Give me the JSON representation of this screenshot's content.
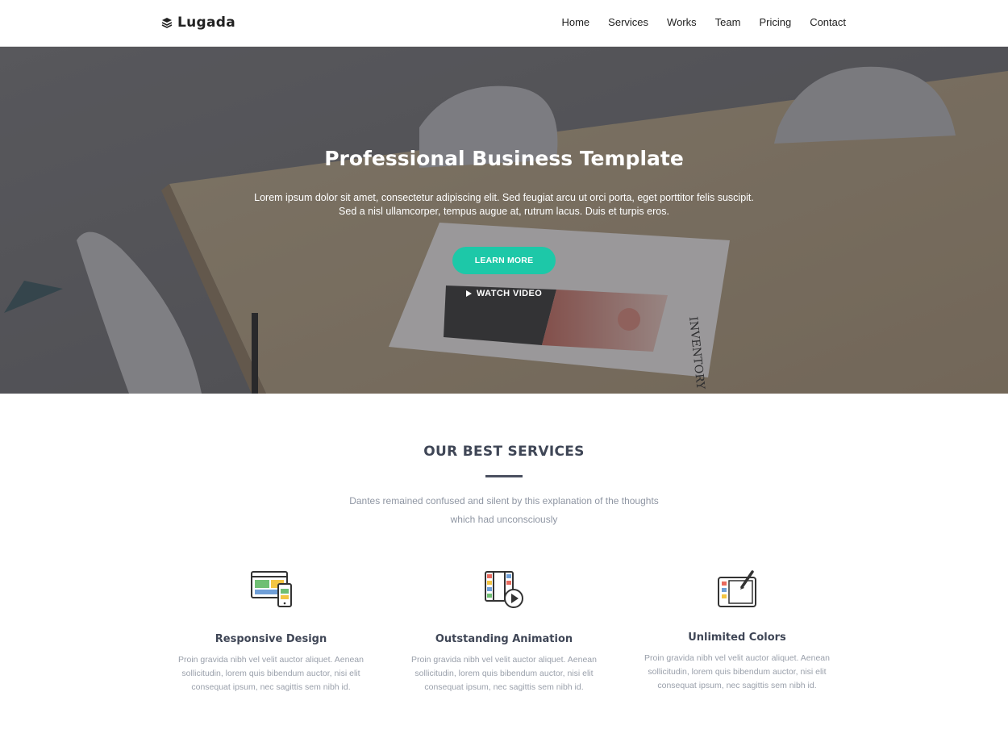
{
  "brand": {
    "name": "Lugada",
    "icon": "layers-icon"
  },
  "nav": {
    "items": [
      {
        "label": "Home"
      },
      {
        "label": "Services"
      },
      {
        "label": "Works"
      },
      {
        "label": "Team"
      },
      {
        "label": "Pricing"
      },
      {
        "label": "Contact"
      }
    ]
  },
  "hero": {
    "title": "Professional Business Template",
    "subtitle_line1": "Lorem ipsum dolor sit amet, consectetur adipiscing elit. Sed feugiat arcu ut orci porta, eget porttitor felis suscipit.",
    "subtitle_line2": "Sed a nisl ullamcorper, tempus augue at, rutrum lacus. Duis et turpis eros.",
    "cta_label": "LEARN MORE",
    "video_label": "WATCH VIDEO",
    "magazine_title": "INVENTORY",
    "accent_color": "#1dc8a8"
  },
  "services": {
    "title": "OUR BEST SERVICES",
    "subtitle_line1": "Dantes remained confused and silent by this explanation of the thoughts",
    "subtitle_line2": "which had unconsciously",
    "items": [
      {
        "icon": "responsive-devices-icon",
        "title": "Responsive Design",
        "text_line1": "Proin gravida nibh vel velit auctor aliquet. Aenean",
        "text_line2": "sollicitudin, lorem quis bibendum auctor, nisi elit",
        "text_line3": "consequat ipsum, nec sagittis sem nibh id."
      },
      {
        "icon": "film-play-icon",
        "title": "Outstanding Animation",
        "text_line1": "Proin gravida nibh vel velit auctor aliquet. Aenean",
        "text_line2": "sollicitudin, lorem quis bibendum auctor, nisi elit",
        "text_line3": "consequat ipsum, nec sagittis sem nibh id."
      },
      {
        "icon": "tablet-pen-icon",
        "title": "Unlimited Colors",
        "text_line1": "Proin gravida nibh vel velit auctor aliquet. Aenean",
        "text_line2": "sollicitudin, lorem quis bibendum auctor, nisi elit",
        "text_line3": "consequat ipsum, nec sagittis sem nibh id."
      }
    ]
  }
}
